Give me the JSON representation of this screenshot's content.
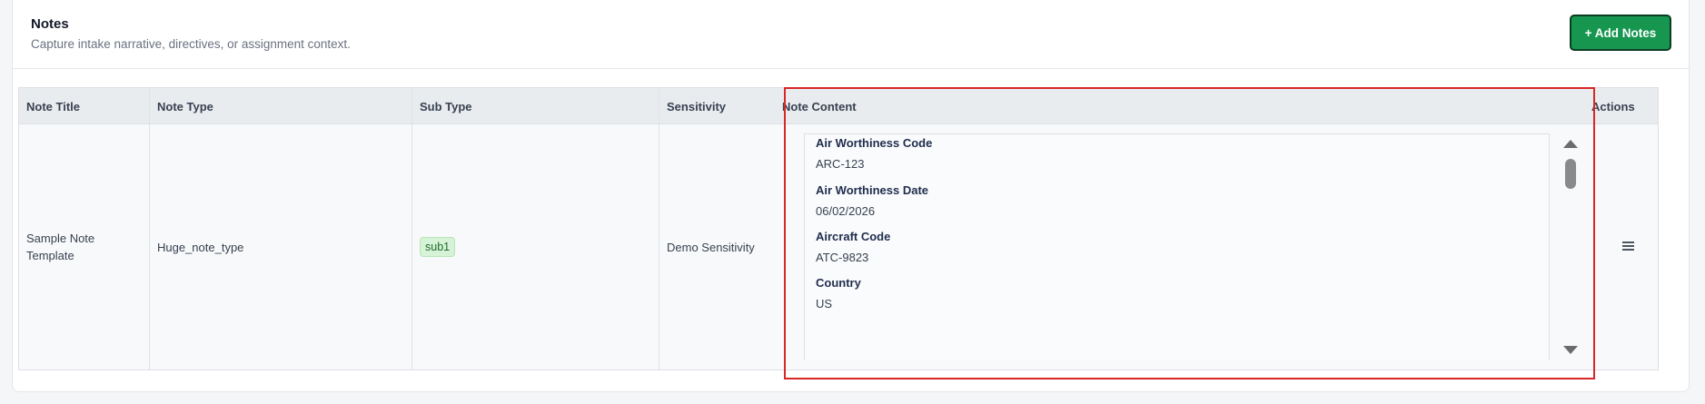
{
  "section": {
    "title": "Notes",
    "subtitle": "Capture intake narrative, directives, or assignment context.",
    "add_button": "+ Add Notes"
  },
  "table": {
    "columns": [
      "Note Title",
      "Note Type",
      "Sub Type",
      "Sensitivity",
      "Note Content",
      "Actions"
    ],
    "rows": [
      {
        "note_title": "Sample Note Template",
        "note_type": "Huge_note_type",
        "sub_type": "sub1",
        "sensitivity": "Demo Sensitivity",
        "content": [
          {
            "label": "Air Worthiness Code",
            "value": "ARC-123"
          },
          {
            "label": "Air Worthiness Date",
            "value": "06/02/2026"
          },
          {
            "label": "Aircraft Code",
            "value": "ATC-9823"
          },
          {
            "label": "Country",
            "value": "US"
          }
        ],
        "actions_icon": "menu-icon"
      }
    ]
  },
  "colors": {
    "accent_green": "#179650",
    "highlight_red": "#d92626",
    "badge_bg": "#d7f3d7"
  }
}
